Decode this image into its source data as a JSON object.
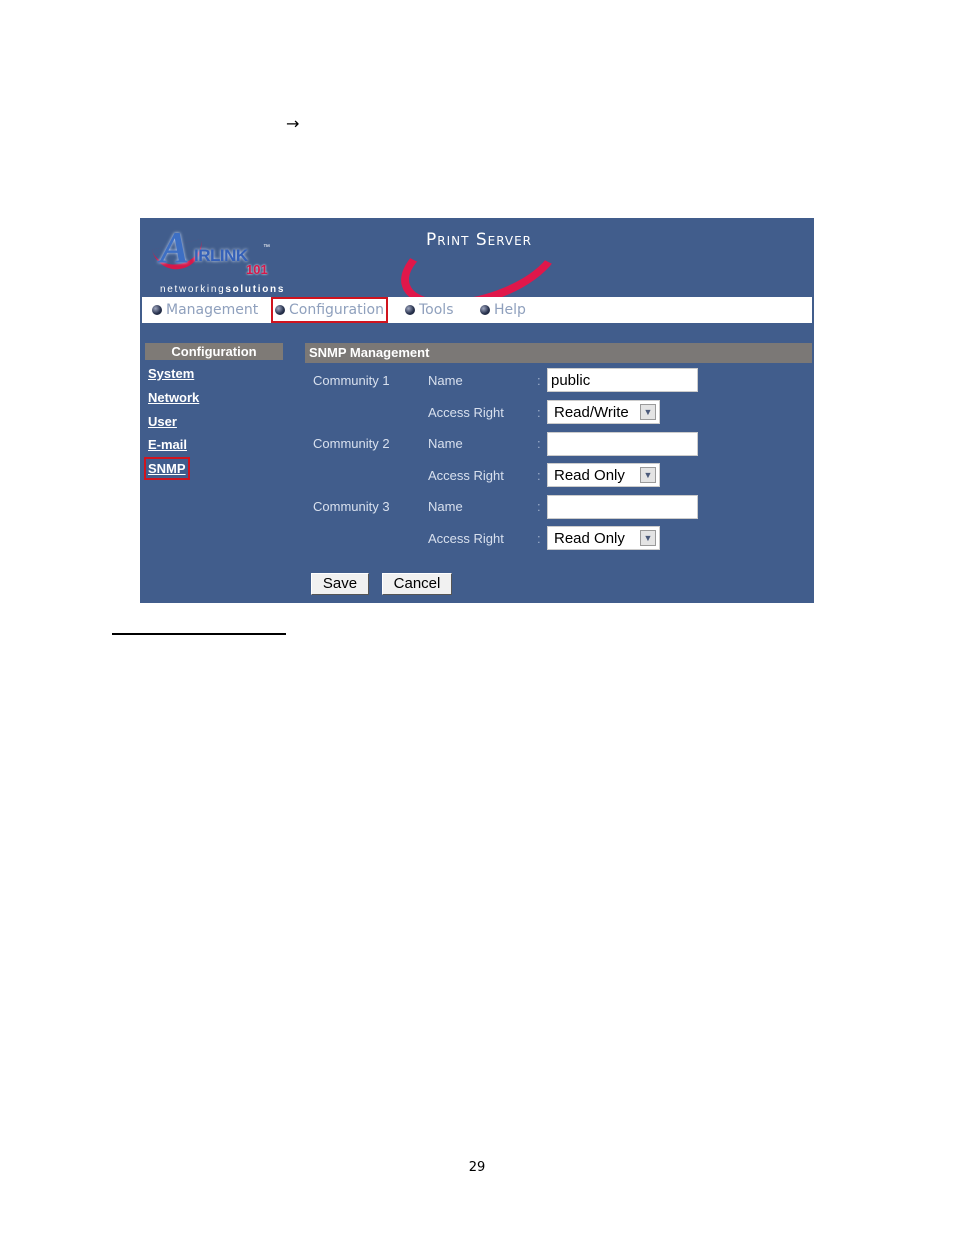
{
  "document": {
    "arrow_symbol": "→",
    "page_number": "29"
  },
  "header": {
    "logo": {
      "letter": "A",
      "brand": "IRLINK",
      "tm": "™",
      "number": "101",
      "tagline_light": "networking",
      "tagline_bold": "solutions"
    },
    "product_title": "Print Server"
  },
  "nav": {
    "items": [
      {
        "label": "Management",
        "active": false
      },
      {
        "label": "Configuration",
        "active": true
      },
      {
        "label": "Tools",
        "active": false
      },
      {
        "label": "Help",
        "active": false
      }
    ]
  },
  "sidebar": {
    "title": "Configuration",
    "items": [
      {
        "label": "System"
      },
      {
        "label": "Network"
      },
      {
        "label": "User"
      },
      {
        "label": "E-mail"
      },
      {
        "label": "SNMP",
        "active": true
      }
    ]
  },
  "main": {
    "title": "SNMP Management",
    "separator": ":",
    "communities": [
      {
        "label": "Community 1",
        "name_label": "Name",
        "name_value": "public",
        "access_label": "Access Right",
        "access_value": "Read/Write"
      },
      {
        "label": "Community 2",
        "name_label": "Name",
        "name_value": "",
        "access_label": "Access Right",
        "access_value": "Read Only"
      },
      {
        "label": "Community 3",
        "name_label": "Name",
        "name_value": "",
        "access_label": "Access Right",
        "access_value": "Read Only"
      }
    ],
    "dropdown_icon": "▼",
    "save_label": "Save",
    "cancel_label": "Cancel"
  }
}
